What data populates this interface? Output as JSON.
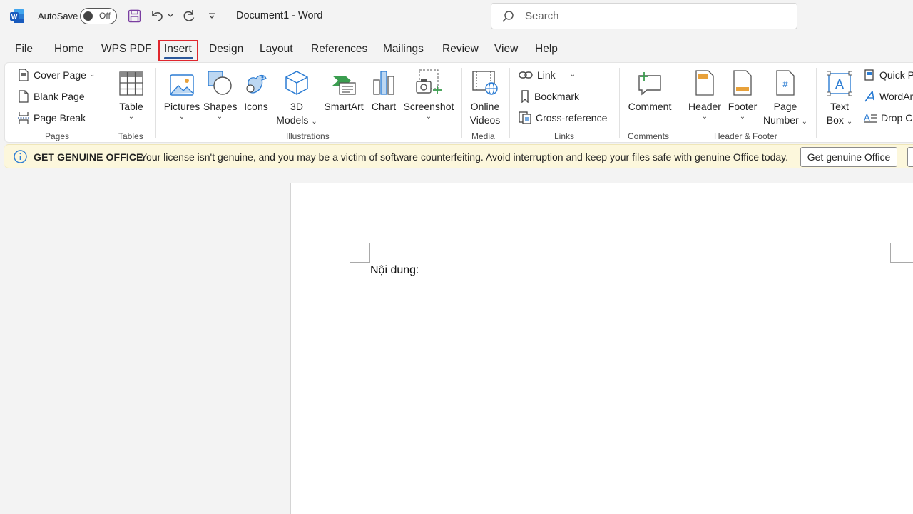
{
  "titlebar": {
    "autosave_label": "AutoSave",
    "autosave_state": "Off",
    "document_title": "Document1  -  Word",
    "search_placeholder": "Search"
  },
  "tabs": [
    {
      "label": "File"
    },
    {
      "label": "Home"
    },
    {
      "label": "WPS PDF"
    },
    {
      "label": "Insert",
      "active": true
    },
    {
      "label": "Design"
    },
    {
      "label": "Layout"
    },
    {
      "label": "References"
    },
    {
      "label": "Mailings"
    },
    {
      "label": "Review"
    },
    {
      "label": "View"
    },
    {
      "label": "Help"
    }
  ],
  "ribbon": {
    "pages": {
      "label": "Pages",
      "cover_page": "Cover Page",
      "blank_page": "Blank Page",
      "page_break": "Page Break"
    },
    "tables": {
      "label": "Tables",
      "table": "Table"
    },
    "illustrations": {
      "label": "Illustrations",
      "pictures": "Pictures",
      "shapes": "Shapes",
      "icons": "Icons",
      "models_line1": "3D",
      "models_line2": "Models",
      "smartart": "SmartArt",
      "chart": "Chart",
      "screenshot": "Screenshot"
    },
    "media": {
      "label": "Media",
      "online_line1": "Online",
      "online_line2": "Videos"
    },
    "links": {
      "label": "Links",
      "link": "Link",
      "bookmark": "Bookmark",
      "cross_reference": "Cross-reference"
    },
    "comments": {
      "label": "Comments",
      "comment": "Comment"
    },
    "header_footer": {
      "label": "Header & Footer",
      "header": "Header",
      "footer": "Footer",
      "page_number_line1": "Page",
      "page_number_line2": "Number"
    },
    "text": {
      "text_box_line1": "Text",
      "text_box_line2": "Box",
      "quick_parts": "Quick Pa",
      "wordart": "WordAr",
      "drop_cap": "Drop Ca"
    }
  },
  "notification": {
    "title": "GET GENUINE OFFICE",
    "message": "Your license isn't genuine, and you may be a victim of software counterfeiting. Avoid interruption and keep your files safe with genuine Office today.",
    "button": "Get genuine Office"
  },
  "document": {
    "body_text": "Nội dung:"
  },
  "colors": {
    "accent": "#2b579a",
    "highlight_box": "#e0262d",
    "notification_bg": "#fcf7dc"
  }
}
